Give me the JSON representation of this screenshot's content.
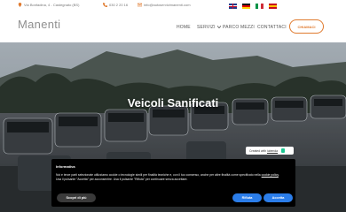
{
  "topbar": {
    "address": "Via Bonfadina, 4 - Castegnato (BS)",
    "phone": "030 2 20 16",
    "email": "info@autoservizimanenti.com"
  },
  "languages": [
    "English",
    "Deutsch",
    "Italiano",
    "Español"
  ],
  "nav": {
    "logo": "Manenti",
    "links": [
      "HOME",
      "SERVIZI",
      "PARCO MEZZI",
      "CONTATTACI"
    ],
    "cta": "CHIAMACI"
  },
  "hero": {
    "title": "Veicoli Sanificati"
  },
  "iubenda": {
    "prefix": "Created with",
    "brand": "iubenda"
  },
  "cookie": {
    "title": "Informativa",
    "text_main": "Noi e terze parti selezionate utilizziamo cookie o tecnologie simili per finalità tecniche e, con il tuo consenso, anche per altre finalità come specificato nella",
    "policy_link": "cookie policy",
    "text_after": "Usa il pulsante \"Accetta\" per acconsentire. Usa il pulsante \"Rifiuta\" per continuare senza accettare.",
    "more": "Scopri di più",
    "reject": "Rifiuta",
    "accept": "Accetta"
  },
  "colors": {
    "accent": "#e07a2e",
    "button_blue": "#2b7de9",
    "cookie_bg": "#000000"
  }
}
